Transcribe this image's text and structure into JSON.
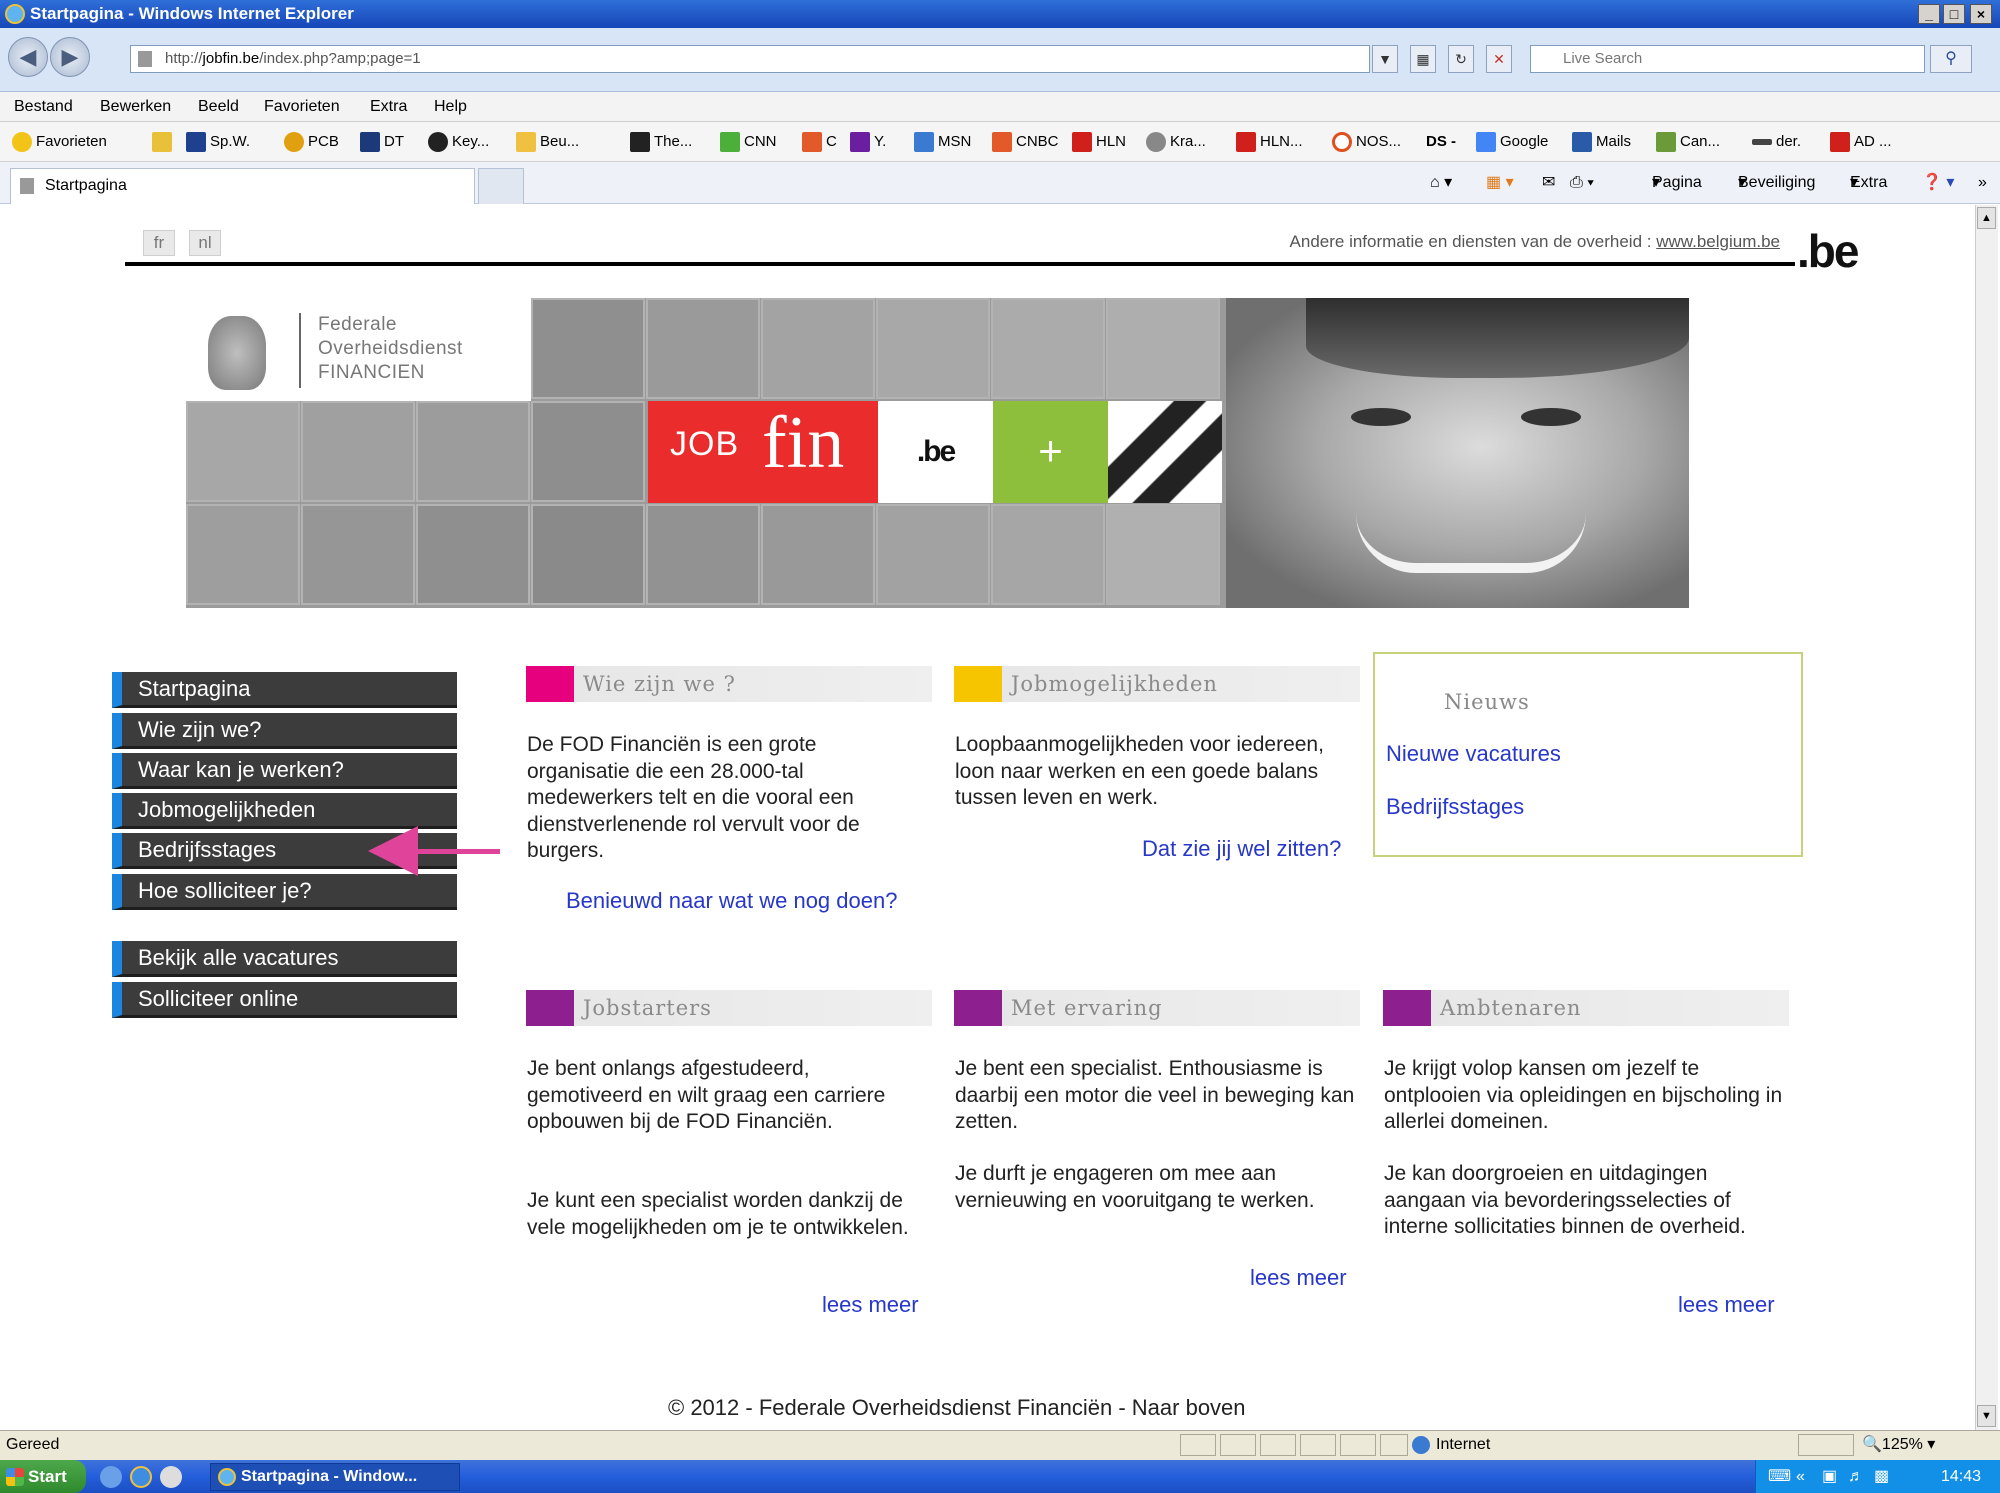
{
  "window": {
    "title": "Startpagina - Windows Internet Explorer",
    "min_label": "_",
    "max_label": "□",
    "close_label": "×"
  },
  "address": {
    "url_prefix": "http://",
    "url_domain": "jobfin.be",
    "url_path": "/index.php?amp;page=1",
    "search_placeholder": "Live Search"
  },
  "menubar": {
    "items": [
      "Bestand",
      "Bewerken",
      "Beeld",
      "Favorieten",
      "Extra",
      "Help"
    ]
  },
  "favorites": {
    "label": "Favorieten",
    "items": [
      "Sp.W.",
      "PCB",
      "DT",
      "Key...",
      "Beu...",
      "The...",
      "CNN",
      "C",
      "Y.",
      "MSN",
      "CNBC",
      "HLN",
      "Kra...",
      "HLN...",
      "NOS...",
      "DS -",
      "Google",
      "Mails",
      "Can...",
      "der.",
      "AD ..."
    ]
  },
  "tabs": {
    "active": "Startpagina"
  },
  "commandbar": {
    "pagina": "Pagina",
    "beveiliging": "Beveiliging",
    "extra": "Extra"
  },
  "page": {
    "lang_fr": "fr",
    "lang_nl": "nl",
    "gov_info_text": "Andere informatie en diensten van de overheid : ",
    "gov_info_link": "www.belgium.be",
    "be_logo": ".be",
    "banner": {
      "fod_line1": "Federale",
      "fod_line2": "Overheidsdienst",
      "fod_line3": "FINANCIEN",
      "jobfin_job": "JOB",
      "jobfin_fin": "fin",
      "be_text": ".be",
      "plus_text": "+"
    },
    "nav_menu": [
      "Startpagina",
      "Wie zijn we?",
      "Waar kan je werken?",
      "Jobmogelijkheden",
      "Bedrijfsstages",
      "Hoe solliciteer je?"
    ],
    "nav_menu_secondary": [
      "Bekijk alle vacatures",
      "Solliciteer online"
    ],
    "sections": {
      "wie_zijn_we": {
        "title": "Wie zijn we ?",
        "body": "De FOD Financiën is een grote organisatie die een 28.000-tal medewerkers telt en die vooral een dienstverlenende rol vervult voor de burgers.",
        "link": "Benieuwd naar wat we nog doen?"
      },
      "jobmogelijkheden": {
        "title": "Jobmogelijkheden",
        "body": "Loopbaanmogelijkheden voor iedereen, loon naar werken en een goede balans tussen leven en werk.",
        "link": "Dat zie jij wel zitten?"
      },
      "nieuws": {
        "title": "Nieuws",
        "links": [
          "Nieuwe vacatures",
          "Bedrijfsstages"
        ]
      },
      "jobstarters": {
        "title": "Jobstarters",
        "body1": "Je bent onlangs afgestudeerd, gemotiveerd en wilt graag een carriere opbouwen bij de FOD Financiën.",
        "body2": "Je kunt een specialist worden dankzij de vele mogelijkheden om je te ontwikkelen.",
        "link": "lees meer"
      },
      "met_ervaring": {
        "title": "Met ervaring",
        "body1": "Je bent een specialist. Enthousiasme is daarbij een motor die veel in beweging kan zetten.",
        "body2": "Je durft je engageren om mee aan vernieuwing en vooruitgang te werken.",
        "link": "lees meer"
      },
      "ambtenaren": {
        "title": "Ambtenaren",
        "body1": "Je krijgt volop kansen om jezelf te ontplooien via opleidingen en bijscholing in allerlei domeinen.",
        "body2": "Je kan doorgroeien en uitdagingen aangaan via bevorderingsselecties of interne sollicitaties binnen de overheid.",
        "link": "lees meer"
      }
    },
    "footer": "© 2012 - Federale Overheidsdienst Financiën - Naar boven"
  },
  "statusbar": {
    "status": "Gereed",
    "zone": "Internet",
    "zoom": "125%"
  },
  "taskbar": {
    "start": "Start",
    "task_ie": "Startpagina - Window...",
    "clock": "14:43"
  },
  "colors": {
    "menu_bg": "#3c3c3c",
    "menu_accent": "#1a86e0",
    "link": "#2737c8",
    "magenta": "#e6007e",
    "yellow": "#f7c400",
    "purple": "#8e1f8f",
    "jobfin_red": "#ea2c2c",
    "plus_green": "#8dbf3c",
    "arrow": "#e0449a"
  },
  "icons": {
    "back": "back-arrow-icon",
    "forward": "forward-arrow-icon",
    "search": "magnifier-icon",
    "home": "home-icon",
    "help": "help-icon"
  }
}
